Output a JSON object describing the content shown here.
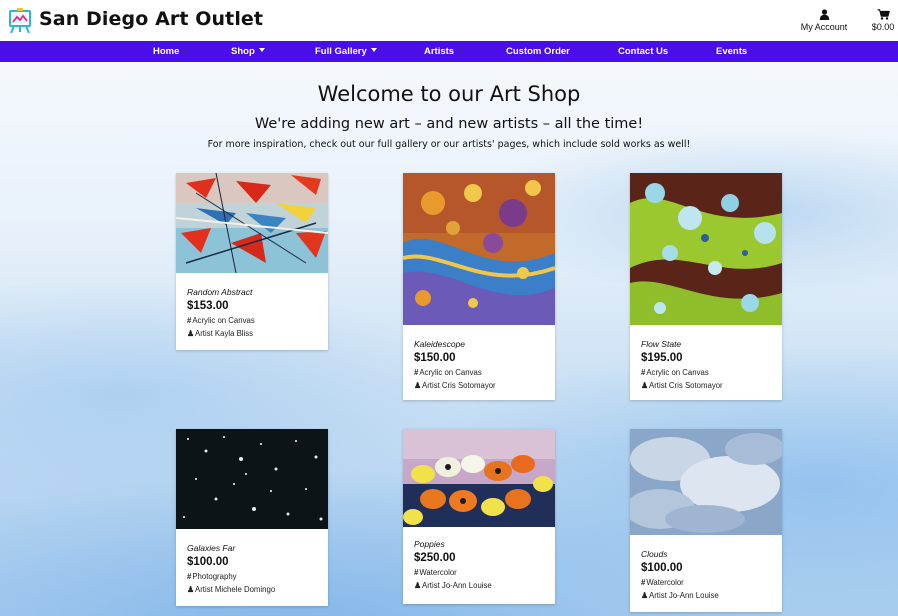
{
  "header": {
    "brand": "San Diego Art Outlet",
    "account_label": "My Account",
    "cart_total": "$0.00"
  },
  "nav": {
    "items": [
      {
        "label": "Home",
        "dropdown": false
      },
      {
        "label": "Shop",
        "dropdown": true
      },
      {
        "label": "Full Gallery",
        "dropdown": true
      },
      {
        "label": "Artists",
        "dropdown": false
      },
      {
        "label": "Custom Order",
        "dropdown": false
      },
      {
        "label": "Contact Us",
        "dropdown": false
      },
      {
        "label": "Events",
        "dropdown": false
      }
    ]
  },
  "intro": {
    "title": "Welcome to our Art Shop",
    "subtitle": "We're adding new art – and new artists – all the time!",
    "text": "For more inspiration, check out our full gallery or our artists' pages, which include sold works as well!"
  },
  "products": [
    {
      "title": "Random Abstract",
      "price": "$153.00",
      "medium": "Acrylic on Canvas",
      "artist": "Artist Kayla Bliss"
    },
    {
      "title": "Kaleidescope",
      "price": "$150.00",
      "medium": "Acrylic on Canvas",
      "artist": "Artist Cris Sotomayor"
    },
    {
      "title": "Flow State",
      "price": "$195.00",
      "medium": "Acrylic on Canvas",
      "artist": "Artist Cris Sotomayor"
    },
    {
      "title": "Galaxies Far",
      "price": "$100.00",
      "medium": "Photography",
      "artist": "Artist Michele Domingo"
    },
    {
      "title": "Poppies",
      "price": "$250.00",
      "medium": "Watercolor",
      "artist": "Artist Jo-Ann Louise"
    },
    {
      "title": "Clouds",
      "price": "$100.00",
      "medium": "Watercolor",
      "artist": "Artist Jo-Ann Louise"
    }
  ],
  "colors": {
    "nav_bg": "#4a0fe8",
    "nav_text": "#ffffff",
    "page_bg_top": "#f4f8fc",
    "page_bg_bottom": "#a9cdef"
  },
  "icons": {
    "logo": "easel-logo-icon",
    "account": "user-icon",
    "cart": "cart-icon",
    "medium": "hash-icon",
    "artist": "person-icon"
  }
}
